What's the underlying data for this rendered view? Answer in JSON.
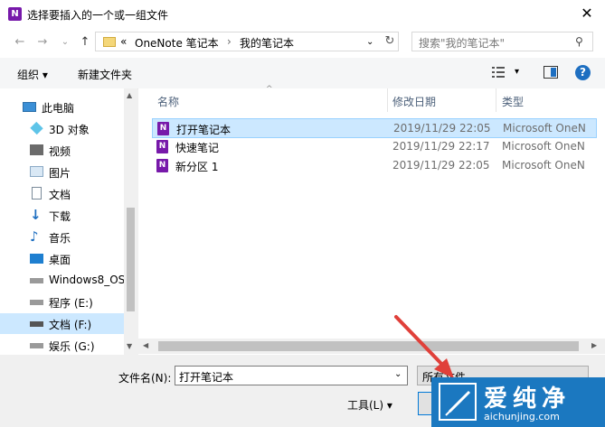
{
  "window": {
    "title": "选择要插入的一个或一组文件",
    "app_icon": "N"
  },
  "address": {
    "prefix": "«",
    "crumb1": "OneNote 笔记本",
    "sep": "›",
    "crumb2": "我的笔记本"
  },
  "search": {
    "placeholder": "搜索\"我的笔记本\""
  },
  "toolbar": {
    "organize": "组织 ▾",
    "new_folder": "新建文件夹",
    "help": "?"
  },
  "sidebar": {
    "items": [
      {
        "label": "此电脑",
        "icon": "computer-icon"
      },
      {
        "label": "3D 对象",
        "icon": "cube-icon"
      },
      {
        "label": "视频",
        "icon": "video-icon"
      },
      {
        "label": "图片",
        "icon": "picture-icon"
      },
      {
        "label": "文档",
        "icon": "document-icon"
      },
      {
        "label": "下载",
        "icon": "download-icon"
      },
      {
        "label": "音乐",
        "icon": "music-icon"
      },
      {
        "label": "桌面",
        "icon": "desktop-icon"
      },
      {
        "label": "Windows8_OS",
        "icon": "drive-icon"
      },
      {
        "label": "程序 (E:)",
        "icon": "drive-icon"
      },
      {
        "label": "文档 (F:)",
        "icon": "drive-icon"
      },
      {
        "label": "娱乐 (G:)",
        "icon": "drive-icon"
      }
    ]
  },
  "columns": {
    "name": "名称",
    "date": "修改日期",
    "type": "类型"
  },
  "files": [
    {
      "name": "打开笔记本",
      "date": "2019/11/29 22:05",
      "type": "Microsoft OneN"
    },
    {
      "name": "快速笔记",
      "date": "2019/11/29 22:17",
      "type": "Microsoft OneN"
    },
    {
      "name": "新分区 1",
      "date": "2019/11/29 22:05",
      "type": "Microsoft OneN"
    }
  ],
  "footer": {
    "filename_label": "文件名(N):",
    "filename_value": "打开笔记本",
    "filetype_value": "所有文件",
    "tools_label": "工具(L) ▾"
  },
  "watermark": {
    "cn": "爱纯净",
    "url": "aichunjing.com"
  },
  "colors": {
    "selection": "#cce8ff",
    "onenote": "#7719aa",
    "watermark": "#1b78c0",
    "arrow": "#e0403a"
  }
}
